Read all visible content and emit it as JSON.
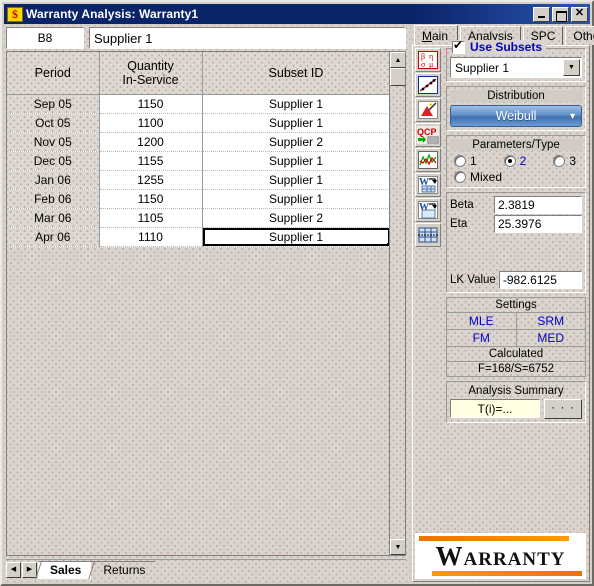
{
  "window": {
    "icon": "dollar-icon",
    "title": "Warranty Analysis: Warranty1",
    "minimize_label": "",
    "maximize_label": "",
    "close_label": "✕"
  },
  "formula_bar": {
    "cell_reference": "B8",
    "value": "Supplier 1"
  },
  "sheet": {
    "columns": [
      "Period",
      "Quantity\nIn-Service",
      "Subset ID"
    ],
    "col_period": "Period",
    "col_qty_line1": "Quantity",
    "col_qty_line2": "In-Service",
    "col_subset": "Subset ID",
    "rows": [
      {
        "period": "Sep 05",
        "quantity": "1150",
        "subset": "Supplier 1"
      },
      {
        "period": "Oct 05",
        "quantity": "1100",
        "subset": "Supplier 1"
      },
      {
        "period": "Nov 05",
        "quantity": "1200",
        "subset": "Supplier 2"
      },
      {
        "period": "Dec 05",
        "quantity": "1155",
        "subset": "Supplier 1"
      },
      {
        "period": "Jan 06",
        "quantity": "1255",
        "subset": "Supplier 1"
      },
      {
        "period": "Feb 06",
        "quantity": "1150",
        "subset": "Supplier 1"
      },
      {
        "period": "Mar 06",
        "quantity": "1105",
        "subset": "Supplier 2"
      },
      {
        "period": "Apr 06",
        "quantity": "1110",
        "subset": "Supplier 1"
      }
    ],
    "selected_row_index": 7,
    "selected_column": "subset"
  },
  "sheet_tabs": {
    "prev_label": "◀",
    "next_label": "▶",
    "items": [
      {
        "label": "Sales",
        "active": true
      },
      {
        "label": "Returns",
        "active": false
      }
    ]
  },
  "panel": {
    "tabs": [
      {
        "label": "Main",
        "active": true,
        "accel": "M",
        "rest": "ain"
      },
      {
        "label": "Analysis",
        "active": false
      },
      {
        "label": "SPC",
        "active": false
      },
      {
        "label": "Other",
        "active": false
      }
    ],
    "toolbar": [
      {
        "name": "parameters-greek-icon",
        "tip": "Beta Eta Sigma Mu"
      },
      {
        "name": "probability-plot-icon",
        "tip": "Plot"
      },
      {
        "name": "distribution-wizard-icon",
        "tip": "Distribution Wizard"
      },
      {
        "name": "qcp-icon",
        "tip": "QCP"
      },
      {
        "name": "trend-chart-icon",
        "tip": "Chart"
      },
      {
        "name": "export-word-table-icon",
        "tip": "Export Table"
      },
      {
        "name": "export-word-doc-icon",
        "tip": "Export Document"
      },
      {
        "name": "data-grid-icon",
        "tip": "Grid"
      }
    ],
    "subsets": {
      "checkbox_label": "Use Subsets",
      "checked": true,
      "selected": "Supplier 1"
    },
    "distribution": {
      "title": "Distribution",
      "selected": "Weibull"
    },
    "parameters_type": {
      "title": "Parameters/Type",
      "options": [
        {
          "label": "1",
          "selected": false
        },
        {
          "label": "2",
          "selected": true
        },
        {
          "label": "3",
          "selected": false
        },
        {
          "label": "Mixed",
          "selected": false
        }
      ]
    },
    "parameters": {
      "beta_label": "Beta",
      "beta_value": "2.3819",
      "eta_label": "Eta",
      "eta_value": "25.3976",
      "lk_label": "LK Value",
      "lk_value": "-982.6125"
    },
    "settings": {
      "title": "Settings",
      "buttons": [
        "MLE",
        "SRM",
        "FM",
        "MED"
      ],
      "calculated_label": "Calculated",
      "calculated_value": "F=168/S=6752"
    },
    "analysis_summary": {
      "title": "Analysis Summary",
      "value": "T(i)=...",
      "more_label": "· · ·"
    },
    "brand": "Warranty"
  },
  "colors": {
    "titlebar": "#0a246a",
    "accent_blue": "#0000cc",
    "brand_orange": "#f07000",
    "face": "#d4d0c8",
    "summary_field": "#ffffe1"
  }
}
